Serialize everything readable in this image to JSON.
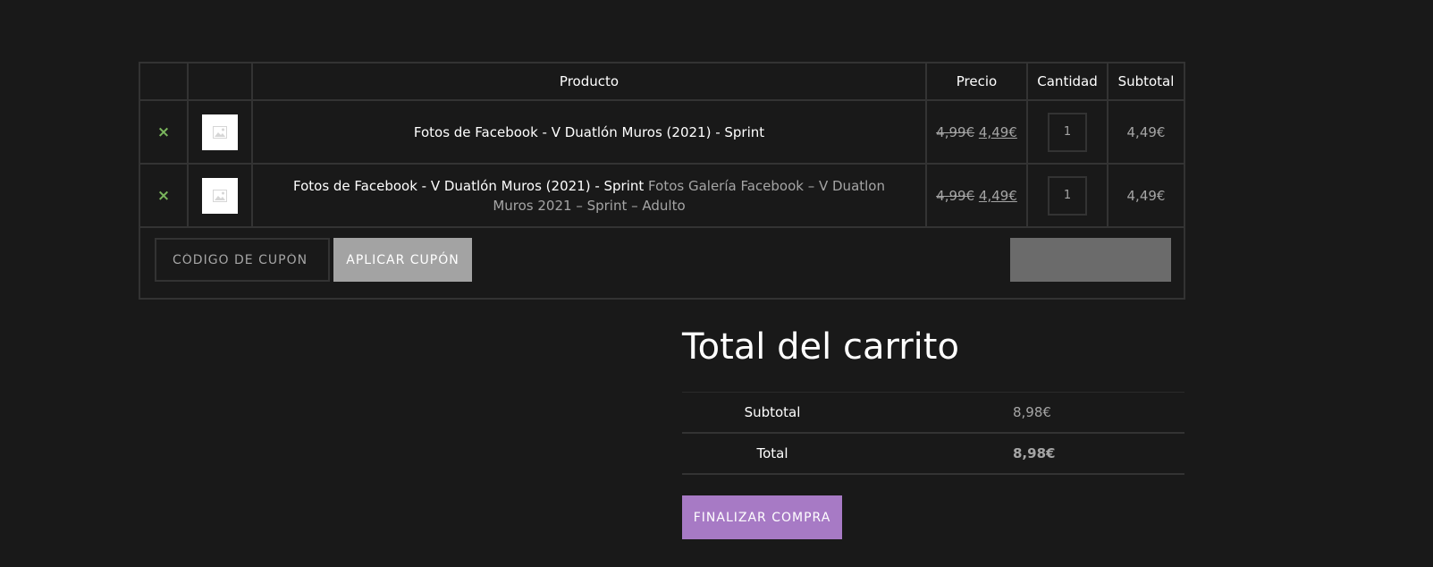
{
  "cart": {
    "headers": {
      "product": "Producto",
      "price": "Precio",
      "quantity": "Cantidad",
      "subtotal": "Subtotal"
    },
    "items": [
      {
        "remove_icon": "×",
        "thumbnail_icon": "placeholder-image-icon",
        "product_name": "Fotos de Facebook - V Duatlón Muros (2021) - Sprint",
        "variation": "",
        "price_old": "4,99€",
        "price_new": "4,49€",
        "quantity": "1",
        "subtotal": "4,49€"
      },
      {
        "remove_icon": "×",
        "thumbnail_icon": "placeholder-image-icon",
        "product_name": "Fotos de Facebook - V Duatlón Muros (2021) - Sprint",
        "variation": "Fotos Galería Facebook – V Duatlon Muros 2021 – Sprint – Adulto",
        "price_old": "4,99€",
        "price_new": "4,49€",
        "quantity": "1",
        "subtotal": "4,49€"
      }
    ],
    "coupon_placeholder": "CÓDIGO DE CUPÓN",
    "apply_coupon_label": "APLICAR CUPÓN",
    "update_cart_label": ""
  },
  "totals": {
    "title": "Total del carrito",
    "subtotal_label": "Subtotal",
    "subtotal_value": "8,98€",
    "total_label": "Total",
    "total_value": "8,98€",
    "checkout_label": "FINALIZAR COMPRA"
  },
  "colors": {
    "background": "#191919",
    "border": "#333333",
    "remove_icon": "#7ab55c",
    "apply_button": "#a3a3a3",
    "update_button": "#6b6b6b",
    "checkout_button": "#a77ac5",
    "muted_text": "#a5a5a5"
  }
}
